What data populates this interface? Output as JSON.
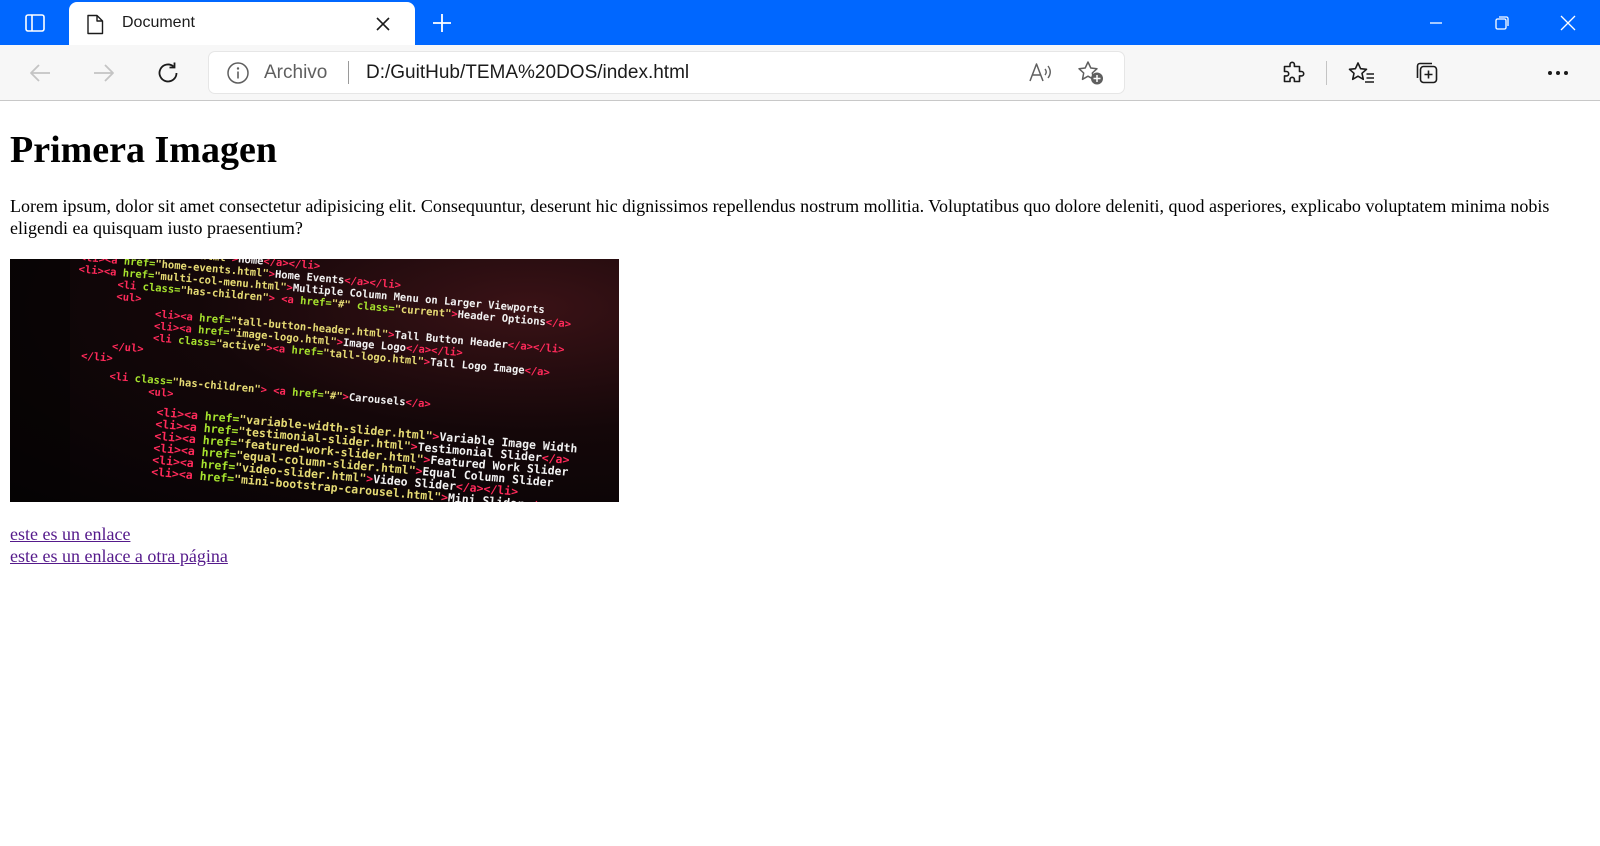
{
  "window": {
    "tab_title": "Document",
    "colors": {
      "titlebar": "#0067ff",
      "visited_link": "#551a8b"
    }
  },
  "icons": {
    "tab_actions": "tab-actions-icon",
    "favicon": "document-icon",
    "close_tab": "close-icon",
    "new_tab": "plus-icon",
    "minimize": "minimize-icon",
    "restore": "restore-icon",
    "close_window": "close-icon",
    "back": "arrow-left-icon",
    "forward": "arrow-right-icon",
    "refresh": "refresh-icon",
    "info": "info-icon",
    "read_aloud": "read-aloud-icon",
    "add_favorite": "star-plus-icon",
    "extensions": "puzzle-icon",
    "favorites": "favorites-icon",
    "collections": "collections-icon",
    "more": "more-icon"
  },
  "addressbar": {
    "site_label": "Archivo",
    "url": "D:/GuitHub/TEMA%20DOS/index.html"
  },
  "page": {
    "heading": "Primera Imagen",
    "paragraph": "Lorem ipsum, dolor sit amet consectetur adipisicing elit. Consequuntur, deserunt hic dignissimos repellendus nostrum mollitia. Voluptatibus quo dolore deleniti, quod asperiores, explicabo voluptatem minima nobis eligendi ea quisquam iusto praesentium?",
    "links": [
      "este es un enlace",
      "este es un enlace a otra página"
    ],
    "image": {
      "code_lines": [
        "<li><a href=\"index.html\">Home</a></li>",
        "<li><a href=\"home-events.html\">Home Events</a></li>",
        "<li><a href=\"multi-col-menu.html\">Multiple Column Menu on Larger Viewports",
        "<li class=\"has-children\"> <a href=\"#\" class=\"current\">Header Options</a>",
        "<ul>",
        "<li><a href=\"tall-button-header.html\">Tall Button Header</a></li>",
        "<li><a href=\"image-logo.html\">Image Logo</a></li>",
        "<li class=\"active\"><a href=\"tall-logo.html\">Tall Logo Image</a>",
        "</ul>",
        "</li>",
        "<li class=\"has-children\"> <a href=\"#\">Carousels</a>",
        "<ul>",
        "<li><a href=\"variable-width-slider.html\">Variable Image Width",
        "<li><a href=\"testimonial-slider.html\">Testimonial Slider</a>",
        "<li><a href=\"featured-work-slider.html\">Featured Work Slider",
        "<li><a href=\"equal-column-slider.html\">Equal Column Slider",
        "<li><a href=\"video-slider.html\">Video Slider</a></li>",
        "<li><a href=\"mini-bootstrap-carousel.html\">Mini Slider</a>"
      ]
    }
  }
}
